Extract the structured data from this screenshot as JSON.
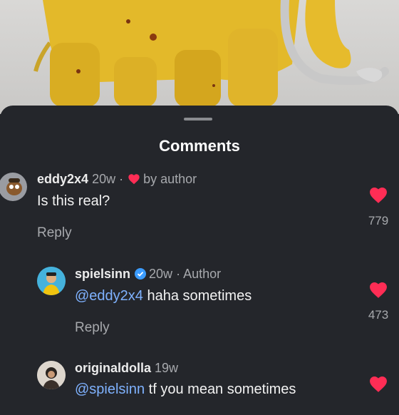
{
  "sheet": {
    "title": "Comments"
  },
  "comments": [
    {
      "username": "eddy2x4",
      "age": "20w",
      "separator": "·",
      "liked_by": "by author",
      "text": "Is this real?",
      "reply_label": "Reply",
      "likes": "779"
    },
    {
      "username": "spielsinn",
      "age": "20w",
      "separator": "·",
      "badge": "Author",
      "mention": "@eddy2x4",
      "text": " haha sometimes",
      "reply_label": "Reply",
      "likes": "473"
    },
    {
      "username": "originaldolla",
      "age": "19w",
      "mention": "@spielsinn",
      "text": " tf you mean sometimes"
    }
  ],
  "colors": {
    "background": "#24262b",
    "heart": "#ff2d55",
    "mention": "#7fb2ff",
    "verified": "#3b9cff"
  },
  "icons": [
    "heart-icon",
    "verified-badge-icon",
    "avatar"
  ]
}
